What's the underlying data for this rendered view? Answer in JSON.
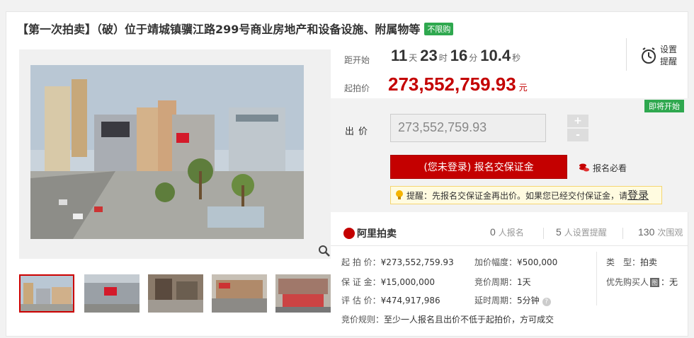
{
  "title": "【第一次拍卖】（破）位于靖城镇骥江路299号商业房地产和设备设施、附属物等",
  "title_tag": "不限购",
  "countdown": {
    "label": "距开始",
    "days": "11",
    "days_unit": "天",
    "hours": "23",
    "hours_unit": "时",
    "minutes": "16",
    "minutes_unit": "分",
    "seconds": "10.4",
    "seconds_unit": "秒"
  },
  "start_price": {
    "label": "起拍价",
    "value": "273,552,759.93",
    "unit": "元"
  },
  "reminder": {
    "line1": "设置",
    "line2": "提醒"
  },
  "bid": {
    "badge": "即将开始",
    "label": "出价",
    "value": "273,552,759.93",
    "plus": "+",
    "minus": "-",
    "register_button": "(您未登录) 报名交保证金",
    "must_read": "报名必看",
    "tip_text": "提醒：先报名交保证金再出价。如果您已经交付保证金，请",
    "tip_link": "登录"
  },
  "stats": {
    "brand": "阿里拍卖",
    "registered": "0",
    "registered_label": "人报名",
    "reminders": "5",
    "reminders_label": "人设置提醒",
    "views": "130",
    "views_label": "次围观"
  },
  "details": {
    "start_price_label": "起 拍 价：",
    "start_price": "¥273,552,759.93",
    "deposit_label": "保 证 金：",
    "deposit": "¥15,000,000",
    "appraisal_label": "评 估 价：",
    "appraisal": "¥474,917,986",
    "increment_label": "加价幅度：",
    "increment": "¥500,000",
    "cycle_label": "竞价周期：",
    "cycle": "1天",
    "delay_label": "延时周期：",
    "delay": "5分钟",
    "help_icon": "?",
    "type_label": "类　型：",
    "type": "拍卖",
    "priority_label": "优先购买人",
    "priority_icon": "图",
    "priority": "：无",
    "rule_label": "竞价规则：",
    "rule": "至少一人报名且出价不低于起拍价，方可成交"
  },
  "colors": {
    "accent": "#c40000",
    "green": "#2fa84f"
  }
}
